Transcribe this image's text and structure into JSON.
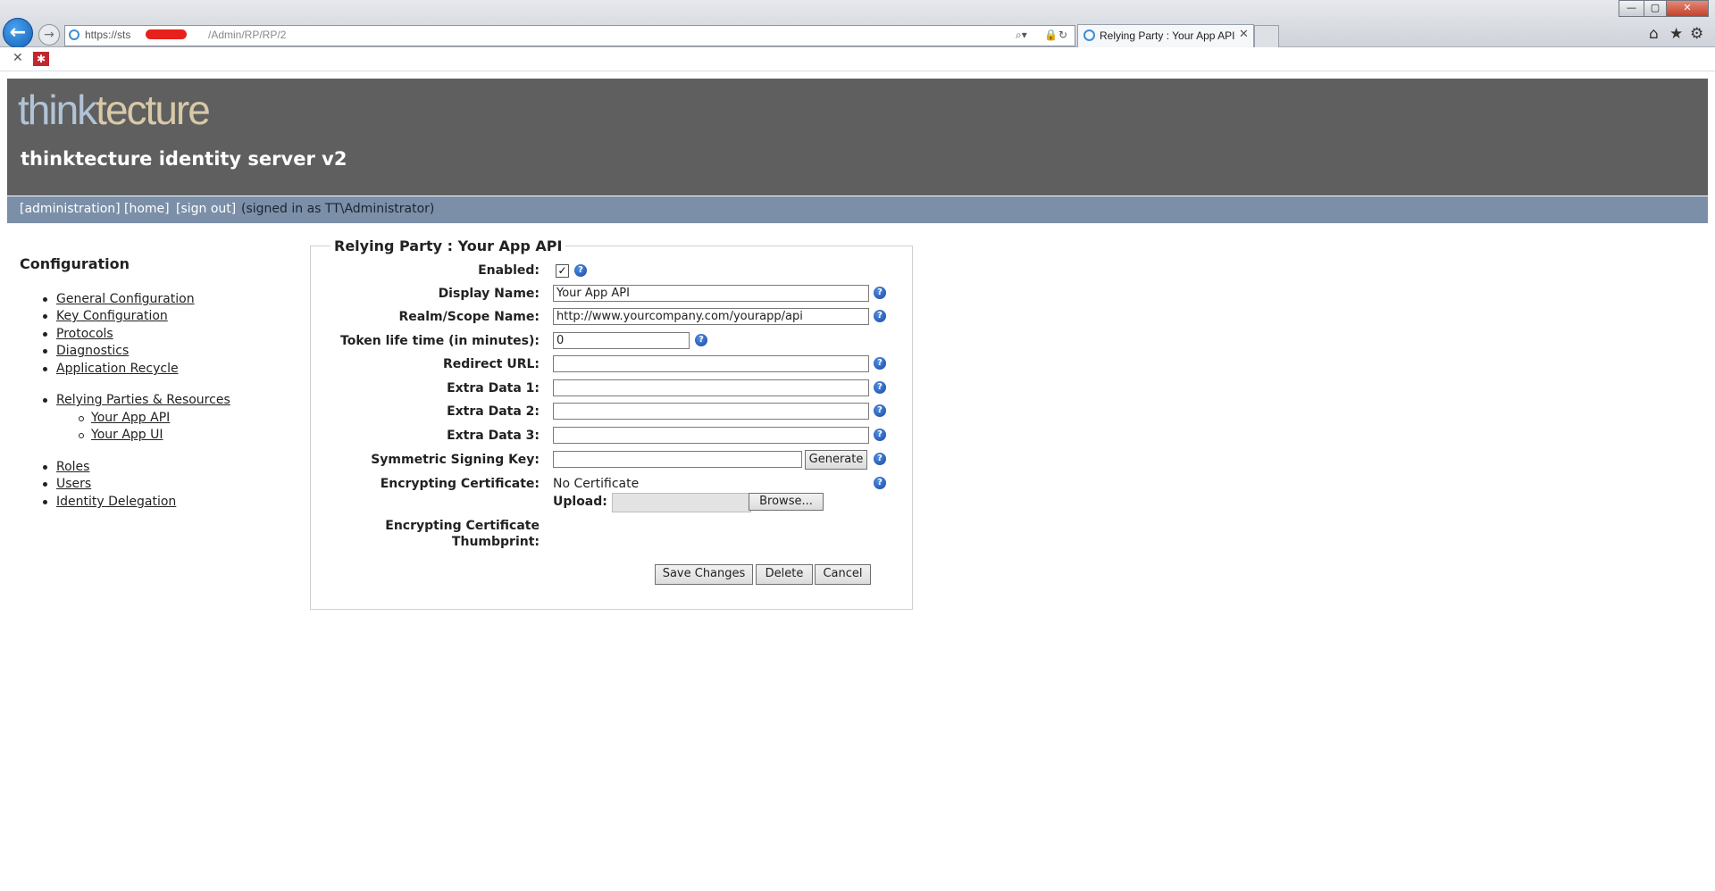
{
  "browser": {
    "url_prefix": "https://sts",
    "url_path": "/Admin/RP/RP/2",
    "tab_title": "Relying Party : Your App API",
    "tab_close": "✕",
    "window_buttons": [
      "—",
      "▢",
      "✕"
    ],
    "toolbar_icons": [
      "home-icon",
      "star-icon",
      "gear-icon"
    ],
    "favorites_close": "✕"
  },
  "header": {
    "logo_think": "think",
    "logo_tecture": "tecture",
    "title": "thinktecture identity server v2"
  },
  "nav": {
    "administration": "[administration]",
    "home": "[home]",
    "signout": "[sign out]",
    "signed_in": "(signed in as TT\\Administrator)"
  },
  "sidebar": {
    "title": "Configuration",
    "group1": [
      "General Configuration",
      "Key Configuration",
      "Protocols",
      "Diagnostics",
      "Application Recycle"
    ],
    "relying_parties": "Relying Parties & Resources",
    "rp_items": [
      "Your App API",
      "Your App UI"
    ],
    "group3": [
      "Roles",
      "Users",
      "Identity Delegation"
    ]
  },
  "form": {
    "legend": "Relying Party : Your App API",
    "labels": {
      "enabled": "Enabled:",
      "display_name": "Display Name:",
      "realm": "Realm/Scope Name:",
      "token_lifetime": "Token life time (in minutes):",
      "redirect_url": "Redirect URL:",
      "extra1": "Extra Data 1:",
      "extra2": "Extra Data 2:",
      "extra3": "Extra Data 3:",
      "symmetric_key": "Symmetric Signing Key:",
      "encrypting_cert": "Encrypting Certificate:",
      "upload": "Upload:",
      "thumbprint_line1": "Encrypting Certificate",
      "thumbprint_line2": "Thumbprint:"
    },
    "values": {
      "enabled": true,
      "enabled_mark": "✓",
      "display_name": "Your App API",
      "realm": "http://www.yourcompany.com/yourapp/api",
      "token_lifetime": "0",
      "redirect_url": "",
      "extra1": "",
      "extra2": "",
      "extra3": "",
      "symmetric_key": "",
      "encrypting_cert": "No Certificate"
    },
    "help_glyph": "?",
    "buttons": {
      "generate": "Generate",
      "browse": "Browse...",
      "save": "Save Changes",
      "delete": "Delete",
      "cancel": "Cancel"
    }
  }
}
